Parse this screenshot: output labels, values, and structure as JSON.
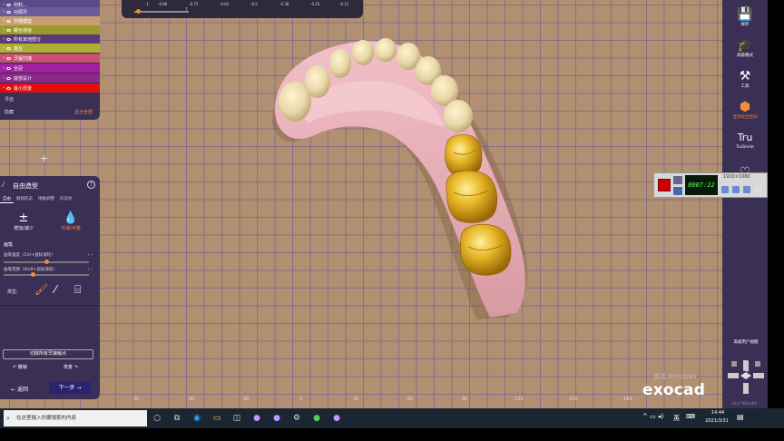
{
  "scale": {
    "ticks": [
      "-1",
      "-0.86",
      "-0.75",
      "-0.62",
      "-0.5",
      "-0.38",
      "-0.25",
      "-0.12"
    ],
    "value": "?"
  },
  "object_list": {
    "rows": [
      {
        "label": "材料...",
        "color": "#5a4a8a"
      },
      {
        "label": "对颌牙",
        "color": "#6a5a9a"
      },
      {
        "label": "扫描模型",
        "color": "#c8a070"
      },
      {
        "label": "螺丝通道",
        "color": "#9a9a2a"
      },
      {
        "label": "所有其他部分",
        "color": "#5a3a7a"
      },
      {
        "label": "基台",
        "color": "#b0b030"
      },
      {
        "label": "牙龈扫描",
        "color": "#c85070"
      },
      {
        "label": "全冠",
        "color": "#a020a0"
      },
      {
        "label": "底部设计",
        "color": "#8a2a8a"
      },
      {
        "label": "最小厚度",
        "color": "#e01010"
      }
    ],
    "footer_1": "牙齿",
    "footer_2": "隐藏",
    "show_all": "显示全部"
  },
  "sculpt": {
    "title": "自由造型",
    "help": "?",
    "tabs": [
      "自由",
      "解剖形态",
      "接触调整",
      "形态体"
    ],
    "mode_add": "增加/减少",
    "mode_smooth": "光滑/平整",
    "section_brush": "画笔",
    "strength_label": "画笔强度（Ctrl+鼠标滚轮）",
    "strength_value": 0.5,
    "size_label": "画笔范围（Shift+鼠标滚轮）",
    "size_value": 0.35,
    "type_label": "类型:",
    "cut_contacts": "切除所有早接触点",
    "undo": "撤销",
    "redo": "恢复",
    "back": "返回",
    "next": "下一步"
  },
  "toolbar": {
    "save": "保存",
    "expert": "高级模式",
    "tools": "工具",
    "occlusion": "显示咬合空间",
    "trusmile_glyph": "Tru",
    "trusmile": "TruSmile",
    "advanced_view": "高级用户视图",
    "version": "v3.0-7662x64"
  },
  "recorder": {
    "time": "0007:22",
    "resolution": "1920×1080"
  },
  "watermark": {
    "activate": "激活 Windows",
    "logo": "exocad"
  },
  "ruler": [
    "90",
    "60",
    "30",
    "0",
    "30",
    "60",
    "90",
    "120",
    "150",
    "180"
  ],
  "taskbar": {
    "search_placeholder": "在这里输入你要搜索的内容",
    "ime": "英",
    "time": "14:44",
    "date": "2021/3/31"
  },
  "colors": {
    "background": "#b09070",
    "grid": "#5a46aa",
    "panel": "#3a2f55",
    "accent": "#f58a3a",
    "crown": "#e0b020",
    "gingiva": "#e8a8b0"
  }
}
